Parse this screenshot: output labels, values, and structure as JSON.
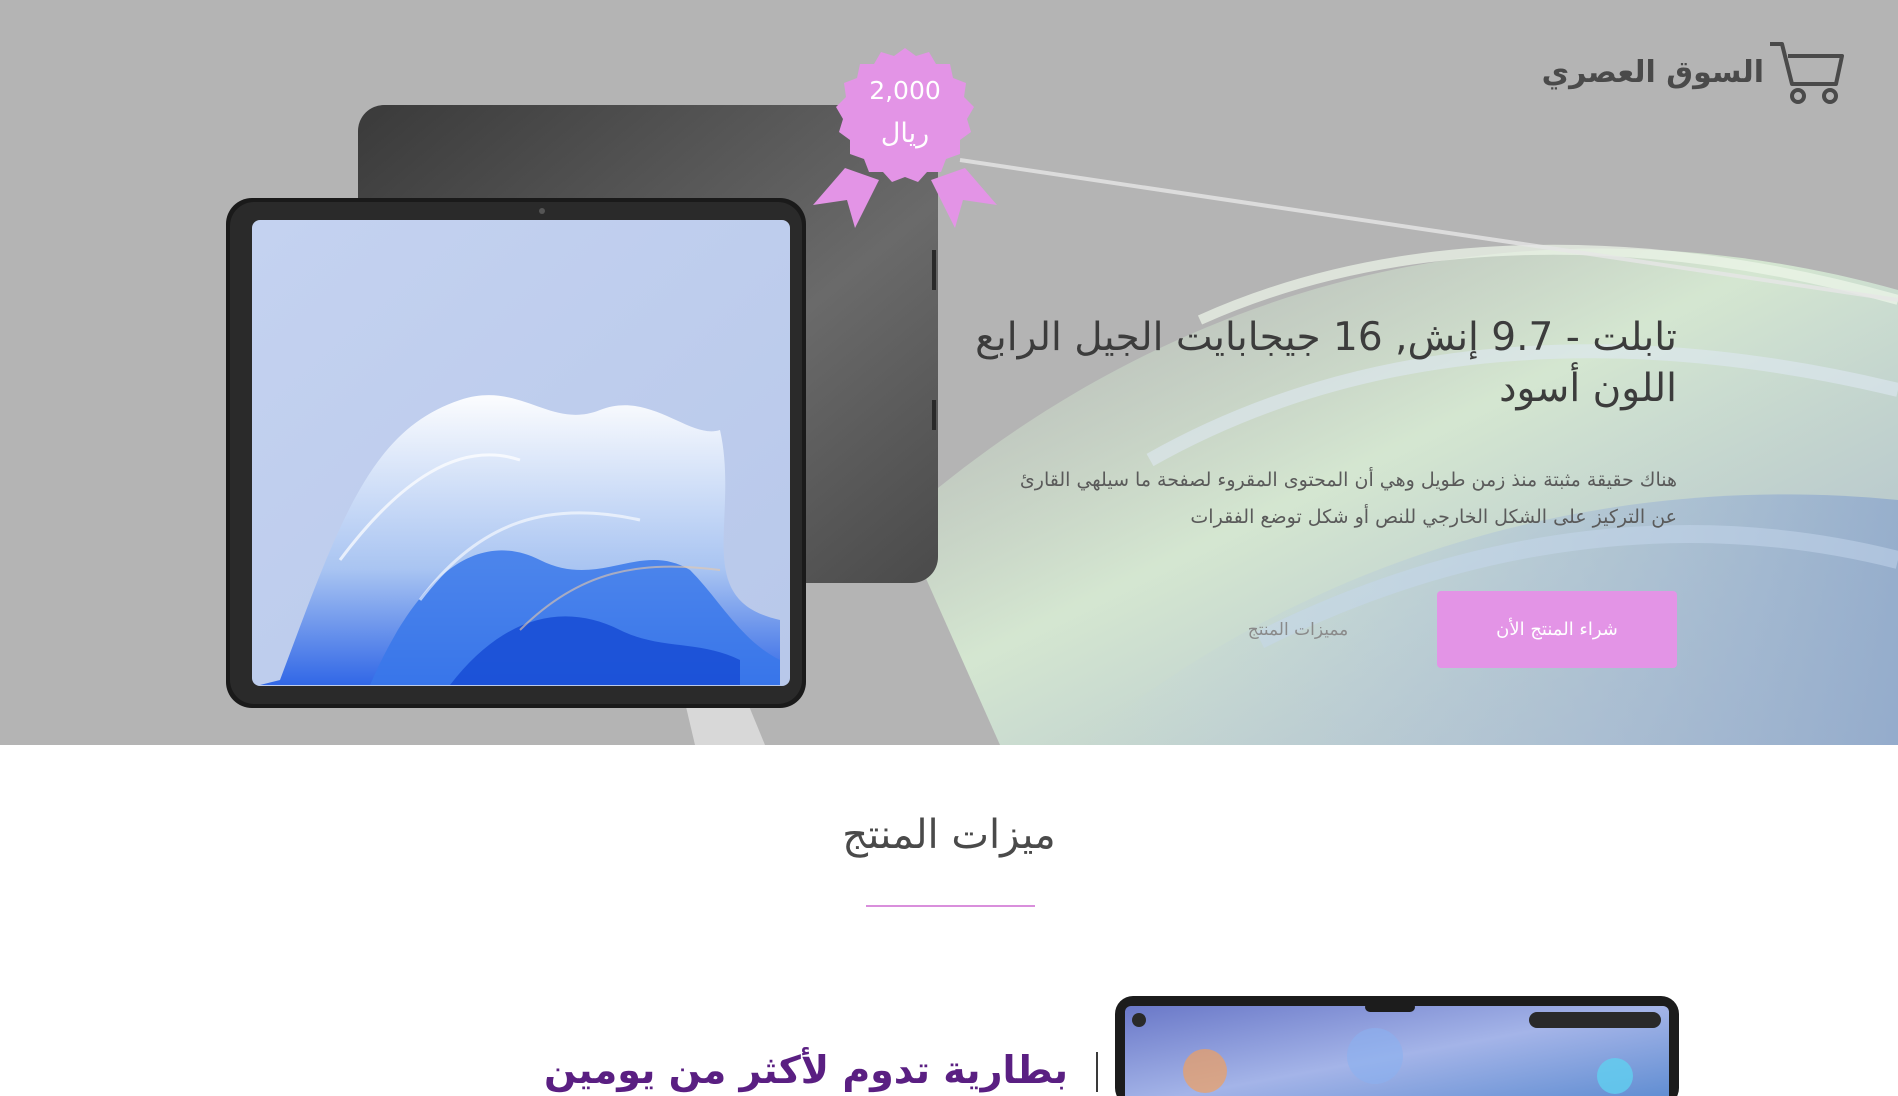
{
  "brand": {
    "name": "السوق العصري",
    "icon": "cart-icon"
  },
  "product": {
    "price": "2,000",
    "currency": "ريال",
    "title_line1": "تابلت - 9.7 إنش, 16 جيجابايت الجيل الرابع",
    "title_line2": "اللون أسود",
    "description_line1": "هناك حقيقة مثبتة منذ زمن طويل وهي أن المحتوى المقروء لصفحة ما سيلهي القارئ",
    "description_line2": "عن التركيز على الشكل الخارجي للنص أو شكل توضع الفقرات"
  },
  "buttons": {
    "buy_now": "شراء المنتج الأن",
    "features": "مميزات المنتج"
  },
  "features": {
    "title": "ميزات المنتج",
    "first_heading": "بطارية تدوم لأكثر من يومين"
  },
  "colors": {
    "accent": "#e394e6",
    "hero_bg": "#b4b4b4",
    "feature_heading": "#5a1f82",
    "text_dark": "#3c3c3c"
  }
}
